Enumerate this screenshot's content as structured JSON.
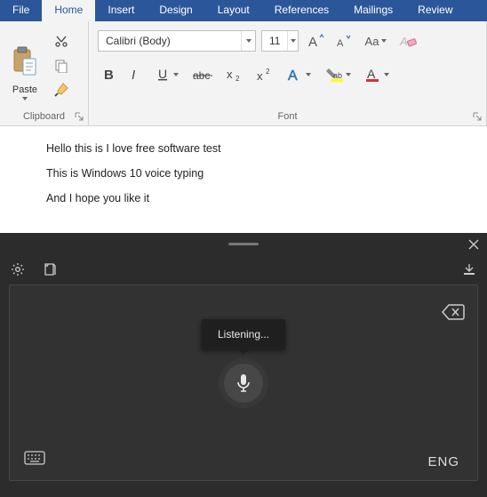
{
  "tabs": {
    "file": "File",
    "home": "Home",
    "insert": "Insert",
    "design": "Design",
    "layout": "Layout",
    "references": "References",
    "mailings": "Mailings",
    "review": "Review"
  },
  "clipboard": {
    "paste": "Paste",
    "groupLabel": "Clipboard"
  },
  "font": {
    "family": "Calibri (Body)",
    "size": "11",
    "caseLabel": "Aa",
    "groupLabel": "Font"
  },
  "document": {
    "lines": [
      "Hello this is I love free software test",
      "This is Windows 10 voice typing",
      "And I hope you like it"
    ]
  },
  "keyboard": {
    "status": "Listening...",
    "lang": "ENG"
  }
}
